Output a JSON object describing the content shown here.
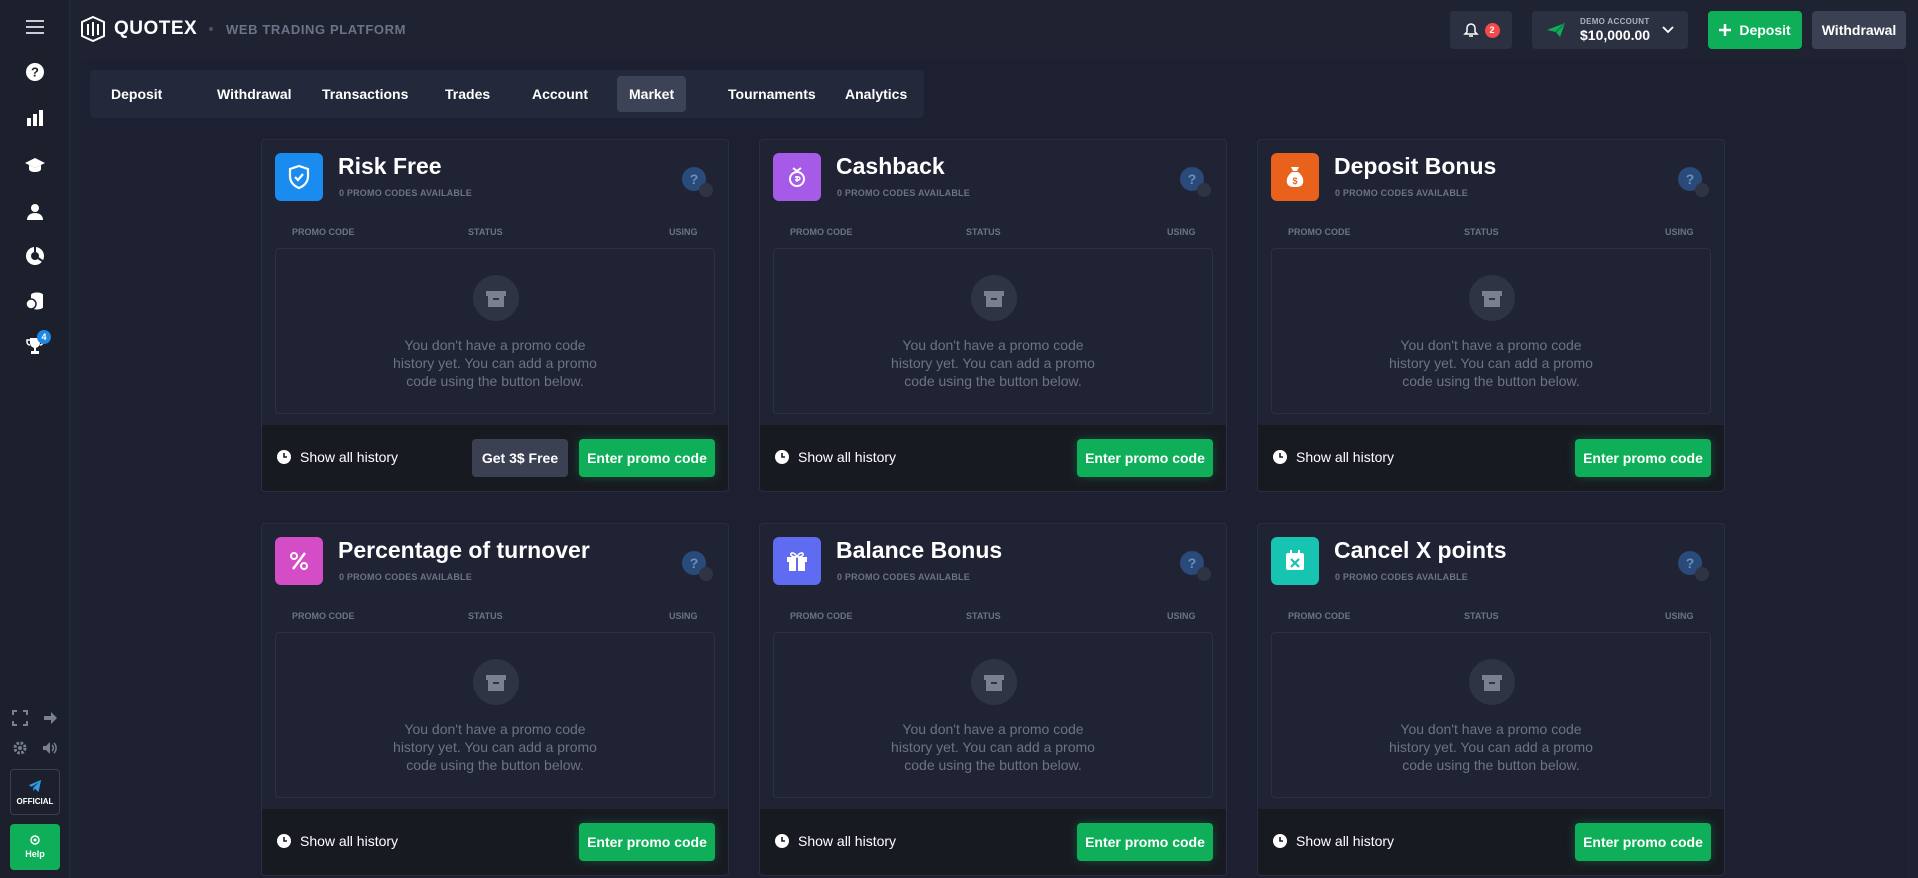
{
  "header": {
    "brand": "QUOTEX",
    "platform": "WEB TRADING PLATFORM",
    "notifications_count": "2",
    "account_type": "DEMO ACCOUNT",
    "account_balance": "$10,000.00",
    "deposit_label": "Deposit",
    "withdrawal_label": "Withdrawal"
  },
  "sidebar": {
    "icons": [
      "help-circle-icon",
      "chart-bars-icon",
      "graduation-cap-icon",
      "user-icon",
      "pie-chart-icon",
      "coins-icon",
      "trophy-icon"
    ],
    "trophy_badge": "4",
    "official_label": "OFFICIAL",
    "help_label": "Help"
  },
  "tabs": [
    {
      "label": "Deposit"
    },
    {
      "label": "Withdrawal"
    },
    {
      "label": "Transactions"
    },
    {
      "label": "Trades"
    },
    {
      "label": "Account"
    },
    {
      "label": "Market",
      "active": true
    },
    {
      "label": "Tournaments"
    },
    {
      "label": "Analytics"
    }
  ],
  "columns": {
    "promo_code": "PROMO CODE",
    "status": "STATUS",
    "using": "USING"
  },
  "empty_text": "You don't have a promo code history yet. You can add a promo code using the button below.",
  "history_label": "Show all history",
  "enter_promo_label": "Enter promo code",
  "cards": [
    {
      "title": "Risk Free",
      "subtitle": "0 PROMO CODES AVAILABLE",
      "icon": "shield-icon",
      "color": "#1a8cf0",
      "extra_button": "Get 3$ Free"
    },
    {
      "title": "Cashback",
      "subtitle": "0 PROMO CODES AVAILABLE",
      "icon": "cashback-icon",
      "color": "#a55be8"
    },
    {
      "title": "Deposit Bonus",
      "subtitle": "0 PROMO CODES AVAILABLE",
      "icon": "money-bag-icon",
      "color": "#e8621c"
    },
    {
      "title": "Percentage of turnover",
      "subtitle": "0 PROMO CODES AVAILABLE",
      "icon": "percent-icon",
      "color": "#d44dc6"
    },
    {
      "title": "Balance Bonus",
      "subtitle": "0 PROMO CODES AVAILABLE",
      "icon": "gift-icon",
      "color": "#5f6bf0"
    },
    {
      "title": "Cancel X points",
      "subtitle": "0 PROMO CODES AVAILABLE",
      "icon": "cancel-points-icon",
      "color": "#17c4b2"
    }
  ]
}
